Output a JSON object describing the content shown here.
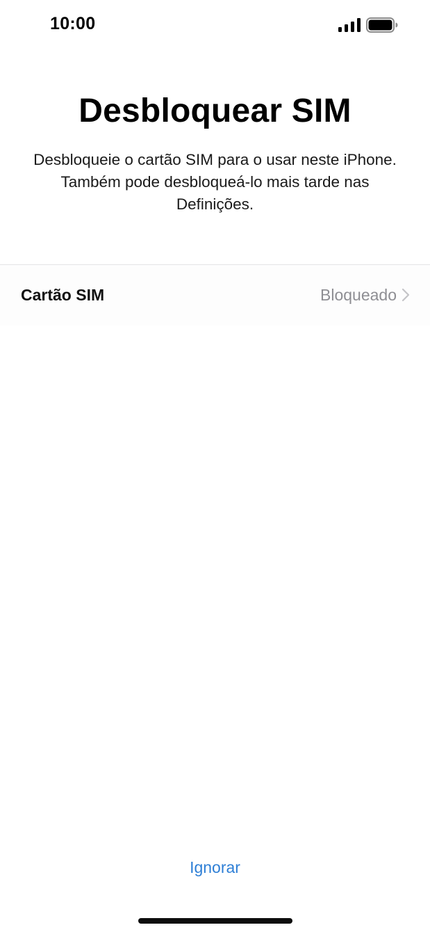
{
  "status_bar": {
    "time": "10:00",
    "signal_icon": "cellular-signal-icon",
    "battery_icon": "battery-full-icon"
  },
  "page": {
    "title": "Desbloquear SIM",
    "subtitle": "Desbloqueie o cartão SIM para o usar neste iPhone. Também pode desbloqueá-lo mais tarde nas Definições."
  },
  "sim_row": {
    "label": "Cartão SIM",
    "value": "Bloqueado",
    "chevron_icon": "chevron-right-icon"
  },
  "footer": {
    "skip_label": "Ignorar"
  },
  "colors": {
    "accent": "#2e7fd6",
    "secondary_text": "#8e8e93",
    "divider": "#e4e4e6"
  }
}
